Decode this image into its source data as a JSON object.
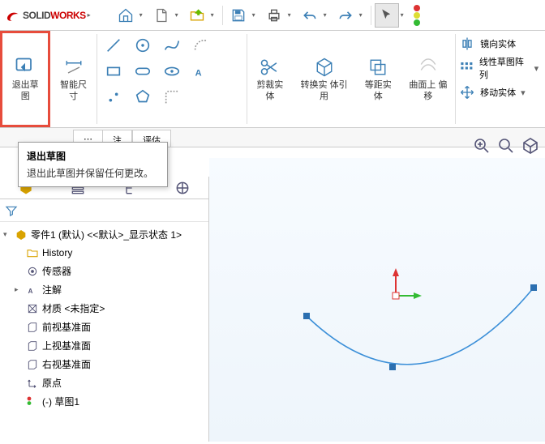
{
  "app": {
    "brand": "SOLID",
    "brand2": "WORKS"
  },
  "ribbon": {
    "exit_sketch": "退出草\n图",
    "smart_dim": "智能尺\n寸",
    "trim": "剪裁实\n体",
    "convert": "转换实\n体引用",
    "offset": "等距实\n体",
    "surface_offset": "曲面上\n偏移",
    "mirror": "镜向实体",
    "linear_pattern": "线性草图阵列",
    "move": "移动实体"
  },
  "tabs": {
    "t1": "注",
    "t2": "评估"
  },
  "tooltip": {
    "title": "退出草图",
    "body": "退出此草图并保留任何更改。"
  },
  "tree": {
    "root": "零件1 (默认) <<默认>_显示状态 1>",
    "history": "History",
    "sensors": "传感器",
    "annotations": "注解",
    "material": "材质 <未指定>",
    "front": "前视基准面",
    "top": "上视基准面",
    "right": "右视基准面",
    "origin": "原点",
    "sketch": "(-) 草图1"
  }
}
